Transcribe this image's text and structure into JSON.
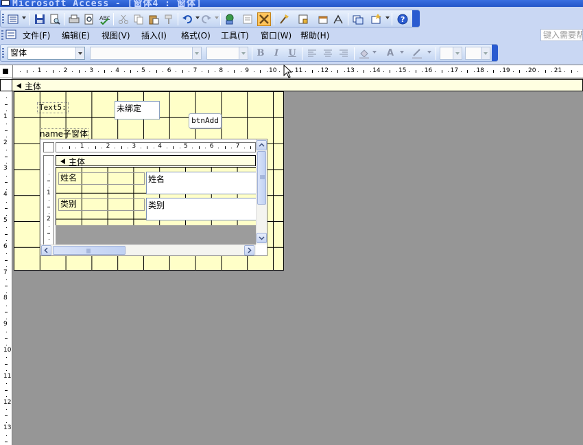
{
  "window": {
    "title": "Microsoft Access - [窗体4 : 窗体]"
  },
  "toolbar_icons": [
    "view-icon",
    "save-icon",
    "file-search-icon",
    "print-icon",
    "print-preview-icon",
    "spelling-icon",
    "cut-icon",
    "copy-icon",
    "paste-icon",
    "format-painter-icon",
    "undo-icon",
    "redo-icon",
    "hyperlink-icon",
    "field-list-icon",
    "toolbox-icon",
    "autoformat-icon",
    "code-icon",
    "properties-icon",
    "build-icon",
    "database-window-icon",
    "new-object-icon",
    "help-icon"
  ],
  "menu": {
    "items": [
      "文件(F)",
      "编辑(E)",
      "视图(V)",
      "插入(I)",
      "格式(O)",
      "工具(T)",
      "窗口(W)",
      "帮助(H)"
    ],
    "help_box": "键入需要帮助"
  },
  "format_toolbar": {
    "object_combo": "窗体",
    "font_combo": "",
    "size_combo": "",
    "bold": "B",
    "italic": "I",
    "underline": "U",
    "font_color_glyph": "A"
  },
  "ruler": {
    "h_numbers": [
      "1",
      "2",
      "3",
      "4",
      "5",
      "6",
      "7",
      "8",
      "9",
      "10",
      "11",
      "12",
      "13",
      "14",
      "15",
      "16",
      "17",
      "18",
      "19",
      "20",
      "21"
    ],
    "v_numbers": [
      "1",
      "2",
      "3",
      "4",
      "5",
      "6",
      "7",
      "8",
      "9",
      "10",
      "11",
      "12",
      "13"
    ],
    "sub_h_numbers": [
      "1",
      "2",
      "3",
      "4",
      "5",
      "6",
      "7"
    ],
    "sub_v_numbers": [
      "1",
      "2"
    ]
  },
  "design": {
    "section_label": "主体",
    "text5_label": "Text5:",
    "unbound_text": "未绑定",
    "btn_add": "btnAdd",
    "subform_label": "name子窗体",
    "subform": {
      "section_label": "主体",
      "name_label": "姓名",
      "name_field": "姓名",
      "category_label": "类别",
      "category_field": "类别"
    }
  }
}
